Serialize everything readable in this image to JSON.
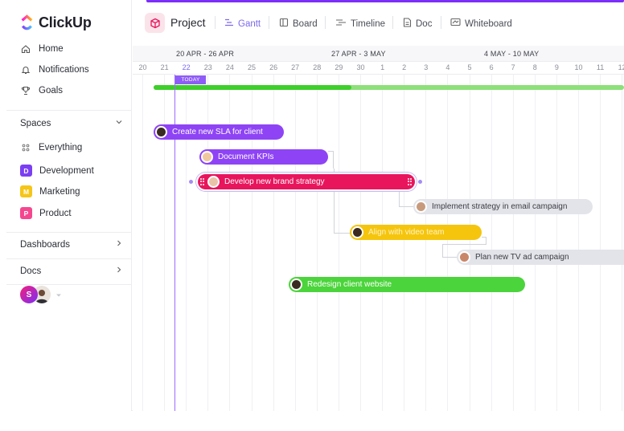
{
  "app": {
    "name": "ClickUp"
  },
  "sidebar": {
    "nav": [
      {
        "label": "Home",
        "icon": "home-icon"
      },
      {
        "label": "Notifications",
        "icon": "bell-icon"
      },
      {
        "label": "Goals",
        "icon": "trophy-icon"
      }
    ],
    "spaces_label": "Spaces",
    "spaces": [
      {
        "label": "Everything",
        "icon": "grid-dots-icon"
      },
      {
        "label": "Development",
        "badge": "D",
        "color": "#7b3ff2"
      },
      {
        "label": "Marketing",
        "badge": "M",
        "color": "#f5c518"
      },
      {
        "label": "Product",
        "badge": "P",
        "color": "#f5478f"
      }
    ],
    "dashboards_label": "Dashboards",
    "docs_label": "Docs",
    "user_initial": "S"
  },
  "header": {
    "project_title": "Project",
    "tabs": [
      {
        "label": "Gantt",
        "icon": "gantt-icon",
        "active": true
      },
      {
        "label": "Board",
        "icon": "board-icon"
      },
      {
        "label": "Timeline",
        "icon": "timeline-icon"
      },
      {
        "label": "Doc",
        "icon": "doc-icon"
      },
      {
        "label": "Whiteboard",
        "icon": "whiteboard-icon"
      }
    ]
  },
  "gantt": {
    "weeks": [
      "20 APR - 26 APR",
      "27 APR - 3 MAY",
      "4 MAY - 10 MAY"
    ],
    "days": [
      "20",
      "21",
      "22",
      "23",
      "24",
      "25",
      "26",
      "27",
      "28",
      "29",
      "30",
      "1",
      "2",
      "3",
      "4",
      "5",
      "6",
      "7",
      "8",
      "9",
      "10",
      "11",
      "12"
    ],
    "today_day": "22",
    "today_label": "TODAY",
    "progress_fraction": 0.42,
    "tasks": [
      {
        "label": "Create new SLA for client",
        "color": "#8e44f5"
      },
      {
        "label": "Document KPIs",
        "color": "#8e44f5"
      },
      {
        "label": "Develop new brand strategy",
        "color": "#e8155d"
      },
      {
        "label": "Implement strategy in email campaign",
        "color": "#e3e4e9"
      },
      {
        "label": "Align with video team",
        "color": "#f5c50e"
      },
      {
        "label": "Plan new TV ad campaign",
        "color": "#e3e4e9"
      },
      {
        "label": "Redesign client website",
        "color": "#4bd43b"
      }
    ]
  },
  "colors": {
    "accent": "#7b68ee",
    "today": "#8e5cf7",
    "progress": "#3fcf2b",
    "progress_track": "#8de07a"
  }
}
